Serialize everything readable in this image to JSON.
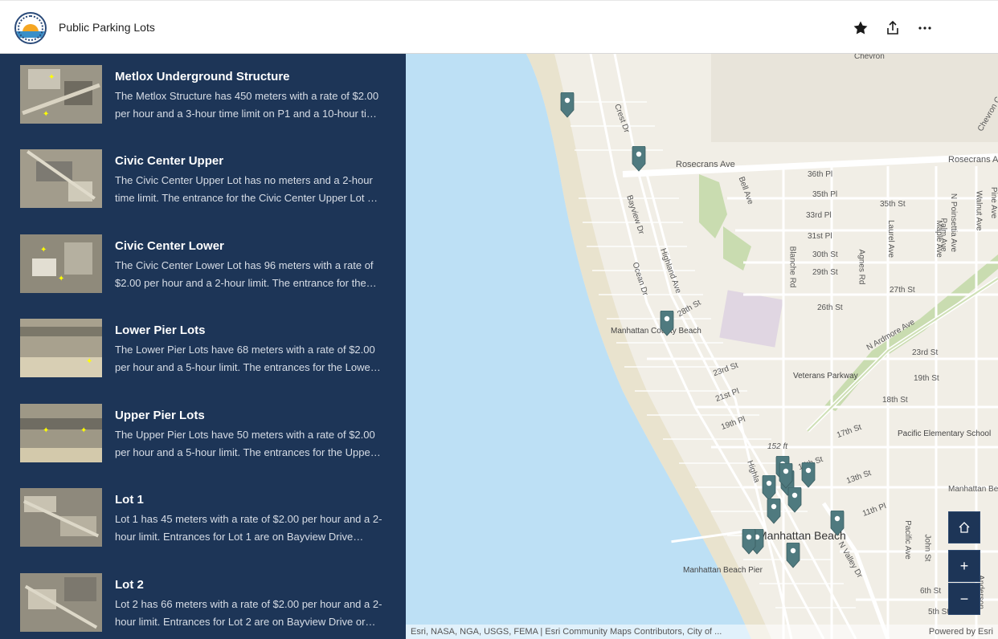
{
  "header": {
    "title": "Public Parking Lots",
    "icons": [
      "favorite-star-icon",
      "share-icon",
      "more-options-icon"
    ]
  },
  "sidebar": {
    "items": [
      {
        "title": "Metlox Underground Structure",
        "description": "The Metlox Structure has 450 meters with a rate of $2.00 per hour and a 3-hour time limit on P1 and a 10-hour ti…"
      },
      {
        "title": "Civic Center Upper",
        "description": "The Civic Center Upper Lot has no meters and a 2-hour time limit. The entrance for the Civic Center Upper Lot …"
      },
      {
        "title": "Civic Center Lower",
        "description": "The Civic Center Lower Lot has 96 meters with a rate of $2.00 per hour and a 2-hour limit. The entrance for the…"
      },
      {
        "title": "Lower Pier Lots",
        "description": "The Lower Pier Lots have 68 meters with a rate of $2.00 per hour and a 5-hour limit. The entrances for the Lowe…"
      },
      {
        "title": "Upper Pier Lots",
        "description": "The Upper Pier Lots have 50 meters with a rate of $2.00 per hour and a 5-hour limit. The entrances for the Uppe…"
      },
      {
        "title": "Lot 1",
        "description": "Lot 1 has 45 meters with a rate of $2.00 per hour and a 2-hour limit. Entrances for Lot 1 are on Bayview Drive…"
      },
      {
        "title": "Lot 2",
        "description": "Lot 2 has 66 meters with a rate of $2.00 per hour and a 2-hour limit. Entrances for Lot 2 are on Bayview Drive or…"
      }
    ]
  },
  "map": {
    "labels": {
      "chevron": "Chevron",
      "chevron_cen": "Chevron Cen",
      "crest_dr": "Crest Dr",
      "rosecrans_ave": "Rosecrans Ave",
      "bell_ave": "Bell Ave",
      "st36": "36th Pl",
      "st35": "35th Pl",
      "st35b": "35th St",
      "st33": "33rd Pl",
      "st31": "31st Pl",
      "st30": "30th St",
      "st29": "29th St",
      "st27": "27th St",
      "st26": "26th St",
      "st28": "28th St",
      "bayview_dr": "Bayview Dr",
      "highland_ave": "Highland Ave",
      "ocean_dr": "Ocean Dr",
      "blanche_rd": "Blanche Rd",
      "agnes_rd": "Agnes Rd",
      "laurel_ave": "Laurel Ave",
      "maple_ave": "Maple Ave",
      "palm_ave": "Palm Ave",
      "poinsettia_ave": "N Poinsettia Ave",
      "walnut_ave": "Walnut Ave",
      "pine_ave": "Pine Ave",
      "mcb": "Manhattan County Beach",
      "ardmore": "N Ardmore Ave",
      "st23": "23rd St",
      "st23b": "23rd St",
      "st21": "21st Pl",
      "st19": "19th Pl",
      "st19b": "19th St",
      "st18": "18th St",
      "st17": "17th St",
      "st15": "15th St",
      "st13": "13th St",
      "st11": "11th Pl",
      "veterans": "Veterans Parkway",
      "elev": "152 ft",
      "pacific_school": "Pacific Elementary School",
      "mb_blvd": "Manhattan Bea",
      "pacific_ave": "Pacific Ave",
      "john_st": "John St",
      "anderson": "Anderson",
      "st6": "6th St",
      "st5": "5th St",
      "valley_dr": "N Valley Dr",
      "town": "Manhattan Beach",
      "pier": "Manhattan Beach Pier",
      "highland_s": "Highla"
    },
    "pins": [
      "parking-lot",
      "parking-lot",
      "parking-lot",
      "parking-lot",
      "parking-lot",
      "parking-lot",
      "parking-lot",
      "parking-lot",
      "parking-lot",
      "parking-lot",
      "parking-lot",
      "parking-lot",
      "parking-lot",
      "parking-lot"
    ],
    "controls": {
      "home_icon": "home-icon",
      "zoom_in": "+",
      "zoom_out": "−"
    },
    "attribution": "Esri, NASA, NGA, USGS, FEMA | Esri Community Maps Contributors, City of ...",
    "powered_by": "Powered by Esri"
  },
  "colors": {
    "sidebar_bg": "#1d3557",
    "water": "#bde0f5",
    "land": "#f1eee6",
    "pin": "#4f7a7f"
  }
}
